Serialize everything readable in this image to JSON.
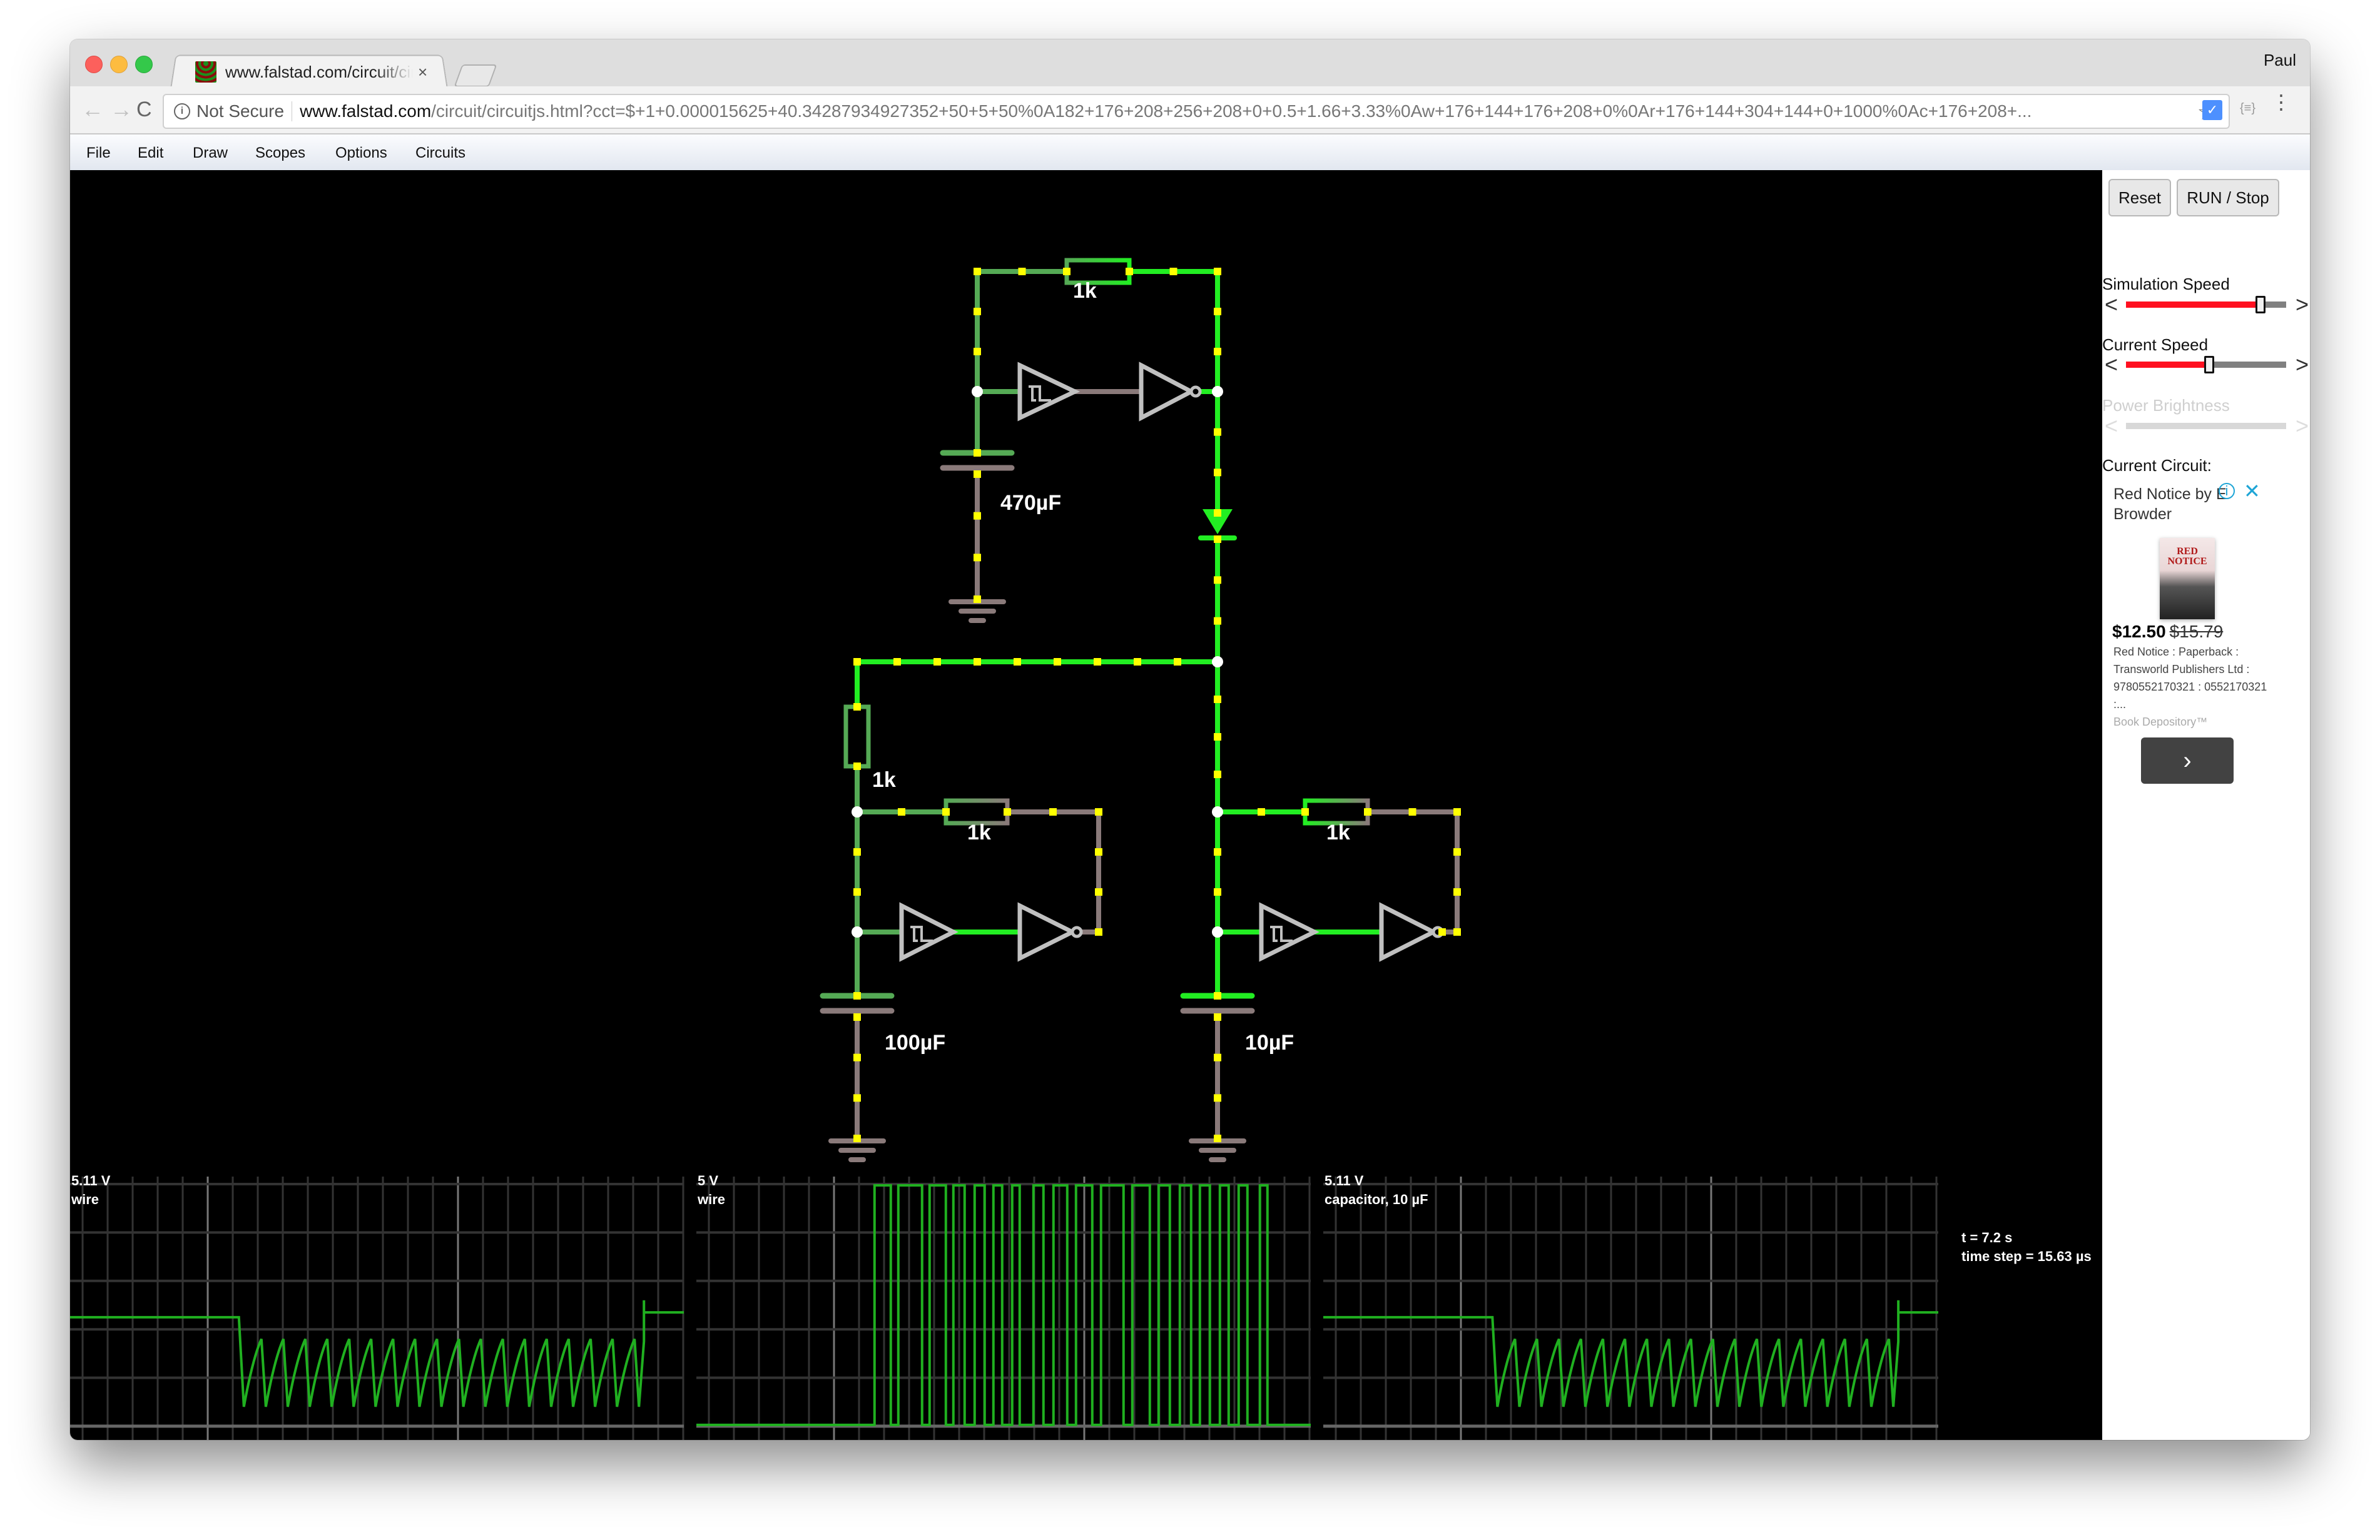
{
  "browser": {
    "tab_title": "www.falstad.com/circuit/circuitjs.html",
    "tab_close": "×",
    "profile_name": "Paul",
    "security_label": "Not Secure",
    "url_host": "www.falstad.com",
    "url_path": "/circuit/circuitjs.html?cct=$+1+0.000015625+40.34287934927352+50+5+50%0A182+176+208+256+208+0+0.5+1.66+3.33%0Aw+176+144+176+208+0%0Ar+176+144+304+144+0+1000%0Ac+176+208+...",
    "nav": {
      "back": "←",
      "forward": "→",
      "reload": "C"
    },
    "star": "☆",
    "kebab": "⋮",
    "ext_icon": "✓",
    "ext2_icon": "{≡}"
  },
  "menu": [
    "File",
    "Edit",
    "Draw",
    "Scopes",
    "Options",
    "Circuits"
  ],
  "sidebar": {
    "reset_label": "Reset",
    "run_stop_label": "RUN / Stop",
    "simulation_speed_label": "Simulation Speed",
    "simulation_speed_value": 0.84,
    "current_speed_label": "Current Speed",
    "current_speed_value": 0.52,
    "power_brightness_label": "Power Brightness",
    "power_brightness_enabled": false,
    "current_circuit_label": "Current Circuit:",
    "arrow_left": "<",
    "arrow_right": ">"
  },
  "ad": {
    "title": "Red Notice by Bill Browder",
    "title_display": "Red Notice by E Browder",
    "info_icon": "i",
    "close_icon": "✕",
    "cover_text": "RED NOTICE",
    "price": "$12.50",
    "old_price": "$15.79",
    "description": "Red Notice : Paperback : Transworld Publishers Ltd : 9780552170321 : 0552170321 :...",
    "source": "Book Depository™",
    "next_icon": "›"
  },
  "circuit": {
    "labels": {
      "r_top": "1k",
      "c_top": "470µF",
      "r_left_series": "1k",
      "r_left_feedback": "1k",
      "c_left": "100µF",
      "r_right_feedback": "1k",
      "c_right": "10µF"
    },
    "colors": {
      "wire_high": "#22ee22",
      "wire_mid": "#55aa55",
      "wire_low": "#8a7a7a",
      "current_dot": "#ffff00",
      "gate": "#c0c0c0",
      "node": "#ffffff"
    }
  },
  "scopes": [
    {
      "max_label": "5.11 V",
      "name": "wire",
      "kind": "sawtooth"
    },
    {
      "max_label": "5 V",
      "name": "wire",
      "kind": "square"
    },
    {
      "max_label": "5.11 V",
      "name": "capacitor, 10 µF",
      "kind": "sawtooth"
    }
  ],
  "status": {
    "time": "t = 7.2 s",
    "time_step": "time step = 15.63 µs"
  }
}
